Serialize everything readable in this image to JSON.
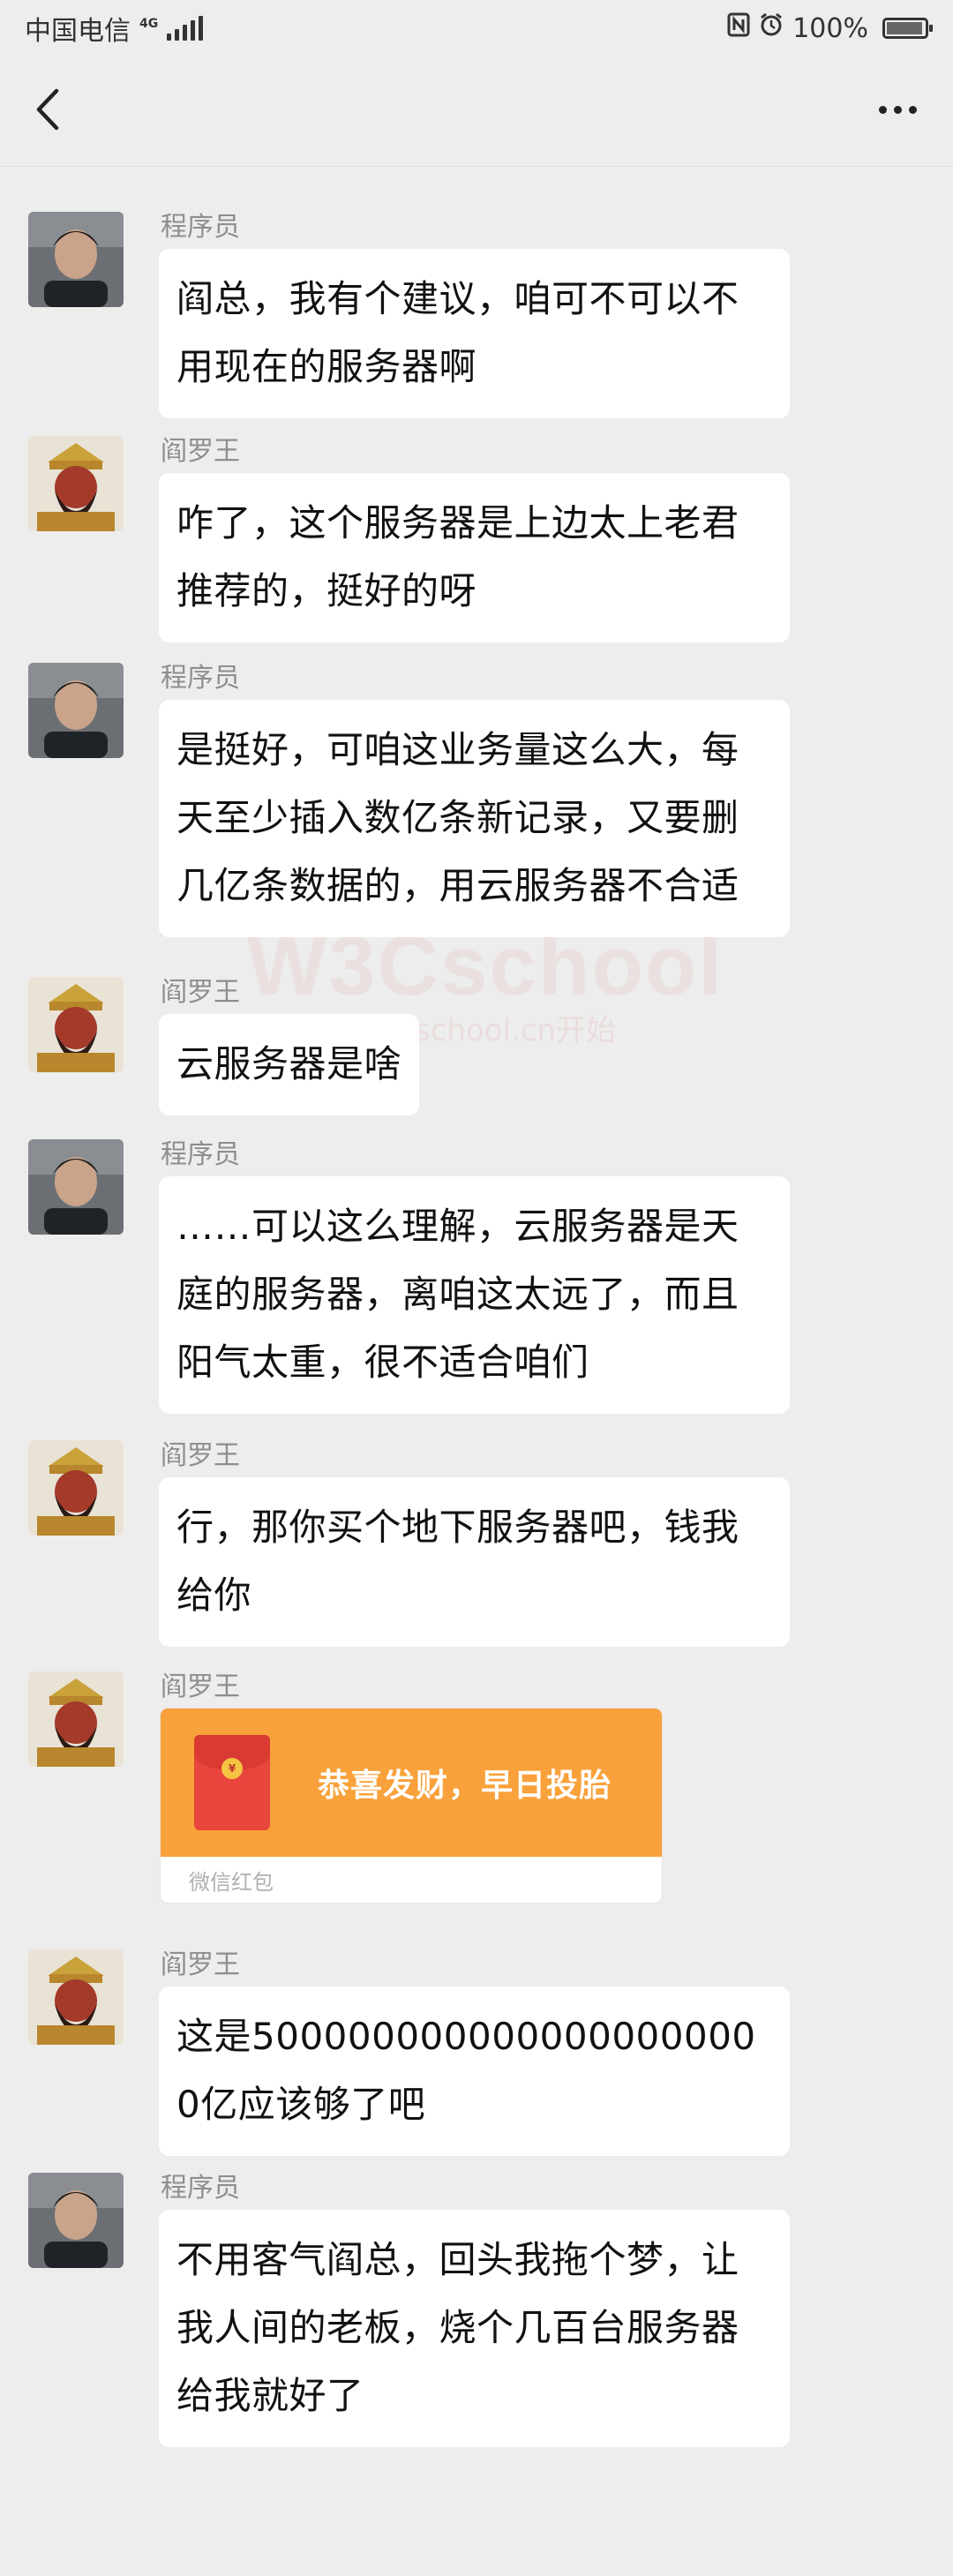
{
  "status_bar": {
    "carrier": "中国电信",
    "network": "4G",
    "battery_text": "100%"
  },
  "nav": {
    "back_icon": "chevron-left-icon",
    "more_icon": "more-dots-icon"
  },
  "watermark": {
    "title": "W3Cschool",
    "subtitle": "w3cschool.cn开始"
  },
  "messages": [
    {
      "sender": "程序员",
      "avatar": "programmer",
      "text": "阎总，我有个建议，咱可不可以不用现在的服务器啊"
    },
    {
      "sender": "阎罗王",
      "avatar": "yama",
      "text": "咋了，这个服务器是上边太上老君推荐的，挺好的呀"
    },
    {
      "sender": "程序员",
      "avatar": "programmer",
      "text": "是挺好，可咱这业务量这么大，每天至少插入数亿条新记录，又要删几亿条数据的，用云服务器不合适"
    },
    {
      "sender": "阎罗王",
      "avatar": "yama",
      "text": "云服务器是啥"
    },
    {
      "sender": "程序员",
      "avatar": "programmer",
      "text": "……可以这么理解，云服务器是天庭的服务器，离咱这太远了，而且阳气太重，很不适合咱们"
    },
    {
      "sender": "阎罗王",
      "avatar": "yama",
      "text": "行，那你买个地下服务器吧，钱我给你"
    },
    {
      "sender": "阎罗王",
      "avatar": "yama",
      "redpacket": {
        "title": "恭喜发财，早日投胎",
        "footer": "微信红包"
      }
    },
    {
      "sender": "阎罗王",
      "avatar": "yama",
      "text": "这是5000000000000000000000亿应该够了吧"
    },
    {
      "sender": "程序员",
      "avatar": "programmer",
      "text": "不用客气阎总，回头我拖个梦，让我人间的老板，烧个几百台服务器给我就好了"
    }
  ]
}
